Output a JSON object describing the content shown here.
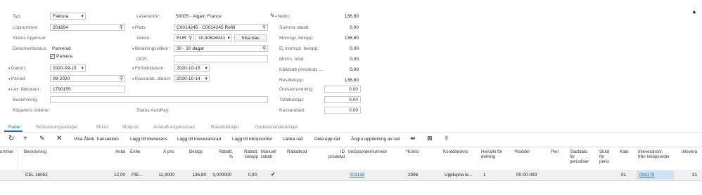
{
  "header": {
    "left": {
      "typ_label": "Typ:",
      "typ_value": "Faktura",
      "lopnummer_label": "Löpnummer:",
      "lopnummer_value": "201694",
      "status_approval_label": "Status Approval:",
      "dokumentstatus_label": "Dokumentstatus:",
      "dokumentstatus_value": "Parkerad",
      "parkera_label": "Parkera",
      "datum_label": "Datum:",
      "datum_value": "2020-09-15",
      "period_label": "Period:",
      "period_value": "09-2020",
      "levfaktura_label": "Lev. fakturanr.:",
      "levfaktura_value": "1790155",
      "beskrivning_label": "Beskrivning:",
      "koparens_label": "Köparens ordernr:"
    },
    "middle": {
      "leverantor_label": "Leverantör:",
      "leverantor_value": "50005 - Algam France",
      "plats_label": "Plats:",
      "plats_value": "C0014245 - C0014245 Refill",
      "valuta_label": "Valuta:",
      "valuta_value": "EUR",
      "kurs_value": "10,40626041",
      "visa_bas_label": "Visa bas",
      "betalningsvillkor_label": "Betalningsvillkor:",
      "betalningsvillkor_value": "30 - 30 dagar",
      "ocr_label": "OCR:",
      "forfallodatum_label": "Förfallodatum:",
      "forfallodatum_value": "2020-10-15",
      "kassarab_label": "Kassarab. datum:",
      "kassarab_value": "2020-10-14",
      "status_autopay_label": "Status AutoPay:"
    },
    "right": {
      "netto_label": "Netto:",
      "netto_value": "136,80",
      "summa_rabatt_label": "Summa rabatt:",
      "summa_rabatt_value": "0,00",
      "momsgr_label": "Momsgr. belopp:",
      "momsgr_value": "136,80",
      "ej_momspl_label": "Ej momspl. belopp:",
      "ej_momspl_value": "0,00",
      "moms_total_label": "Moms, total:",
      "moms_total_value": "0,00",
      "kallskatt_label": "Källskatt (Används ...",
      "kallskatt_value": "0,00",
      "restbelopp_label": "Restbelopp:",
      "restbelopp_value": "136,80",
      "oresavrundning_label": "Öresavrundning:",
      "oresavrundning_value": "0,00",
      "totalbelopp_label": "Totalbelopp:",
      "totalbelopp_value": "0,00",
      "kassarabatt_label": "Kassarabatt:",
      "kassarabatt_value": "0,00"
    }
  },
  "tabs": [
    "Rader",
    "Redovisningsdetaljer",
    "Moms",
    "Motpost",
    "Anskaffningskostnad",
    "Rabattdetaljer",
    "Godkännandedetaljer"
  ],
  "toolbar": {
    "visa_aterk": "Visa Återk. transaktion",
    "lagg_inleverans": "Lägg till inleverans",
    "lagg_inleveransrad": "Lägg till inleveransrad",
    "lagg_inkopsorder": "Lägg till inköpsorder",
    "lanka_rad": "Länka rad",
    "dela_upp_rad": "Dela upp rad",
    "angra_uppdelning": "Ångra uppdelning av rad"
  },
  "grid": {
    "headers": {
      "nummer": "ummer",
      "beskrivning": "Beskrivning",
      "antal": "Antal",
      "enhet": "Enhe",
      "apris": "Á pris",
      "belopp": "Belopp",
      "rabatt_pct": "Rabatt, %",
      "rabatt_belopp": "Rabatt, belopp",
      "manuell_rabatt": "Manuell rabatt",
      "rabattkod": "Rabattkod",
      "id_prisavtal": "ID prisavtal",
      "inkopsordernummer": "Inköpsordernummer",
      "konto": "Konto",
      "kontobeskriv": "Kontobeskriv",
      "hierarki": "Hierarki för delning",
      "koddel": "Koddel",
      "peri": "Peri",
      "startdatum": "Startdatu för periodiser",
      "slutd": "Slutd för perio",
      "kate": "Kate",
      "inleveransnr": "Inleveransnr. från Inköpsorder",
      "inlevera": "Inlevera"
    },
    "row": {
      "beskrivning": "CEL 16052",
      "antal": "12,00",
      "enhet": "PIE...",
      "apris": "11,4000",
      "belopp": "136,80",
      "rabatt_pct": "0,000000",
      "rabatt_belopp": "0,00",
      "inkopsordernummer": "003156",
      "konto": "2996",
      "kontobeskriv": "Upplupna le...",
      "hierarki": "1",
      "koddel": "00-00-000",
      "kate": "01",
      "inleveransnr": "006179",
      "inlevera": "31"
    }
  }
}
